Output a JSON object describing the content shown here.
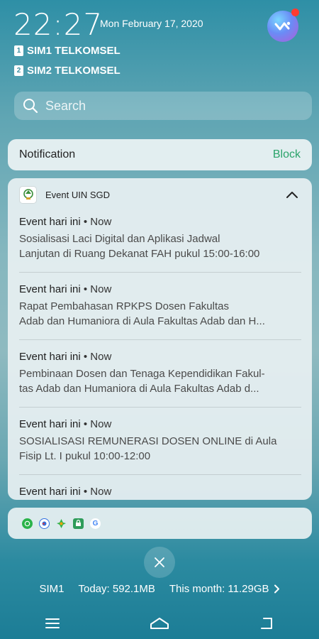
{
  "status": {
    "time": "22:27",
    "date": "Mon February 17, 2020",
    "sim1_slot": "1",
    "sim1": "SIM1 TELKOMSEL",
    "sim2_slot": "2",
    "sim2": "SIM2 TELKOMSEL"
  },
  "search": {
    "placeholder": "Search"
  },
  "notification_bar": {
    "label": "Notification",
    "block": "Block"
  },
  "card": {
    "app_name": "Event UIN SGD",
    "items": [
      {
        "title": "Event hari ini",
        "time": "• Now",
        "line1": "Sosialisasi Laci Digital dan Aplikasi Jadwal",
        "line2": "Lanjutan di Ruang Dekanat FAH pukul 15:00-16:00"
      },
      {
        "title": "Event hari ini",
        "time": "• Now",
        "line1": "Rapat Pembahasan RPKPS Dosen Fakultas",
        "line2": "Adab dan Humaniora di Aula Fakultas Adab dan H..."
      },
      {
        "title": "Event hari ini",
        "time": "• Now",
        "line1": "Pembinaan Dosen dan Tenaga Kependidikan Fakul-",
        "line2": "tas Adab dan Humaniora di Aula Fakultas Adab d..."
      },
      {
        "title": "Event hari ini",
        "time": "• Now",
        "line1": "SOSIALISASI REMUNERASI DOSEN ONLINE di Aula",
        "line2": "Fisip Lt. I pukul 10:00-12:00"
      },
      {
        "title": "Event hari ini",
        "time": "• Now"
      }
    ]
  },
  "app_strip": {
    "icons": [
      "whatsapp-icon",
      "dana-icon",
      "app-green-icon",
      "app-lock-icon",
      "google-icon"
    ],
    "google_letter": "G"
  },
  "data_usage": {
    "sim": "SIM1",
    "today": "Today: 592.1MB",
    "month": "This month: 11.29GB"
  },
  "colors": {
    "block_green": "#2aa36a",
    "notif_dot": "#ff3b30"
  }
}
